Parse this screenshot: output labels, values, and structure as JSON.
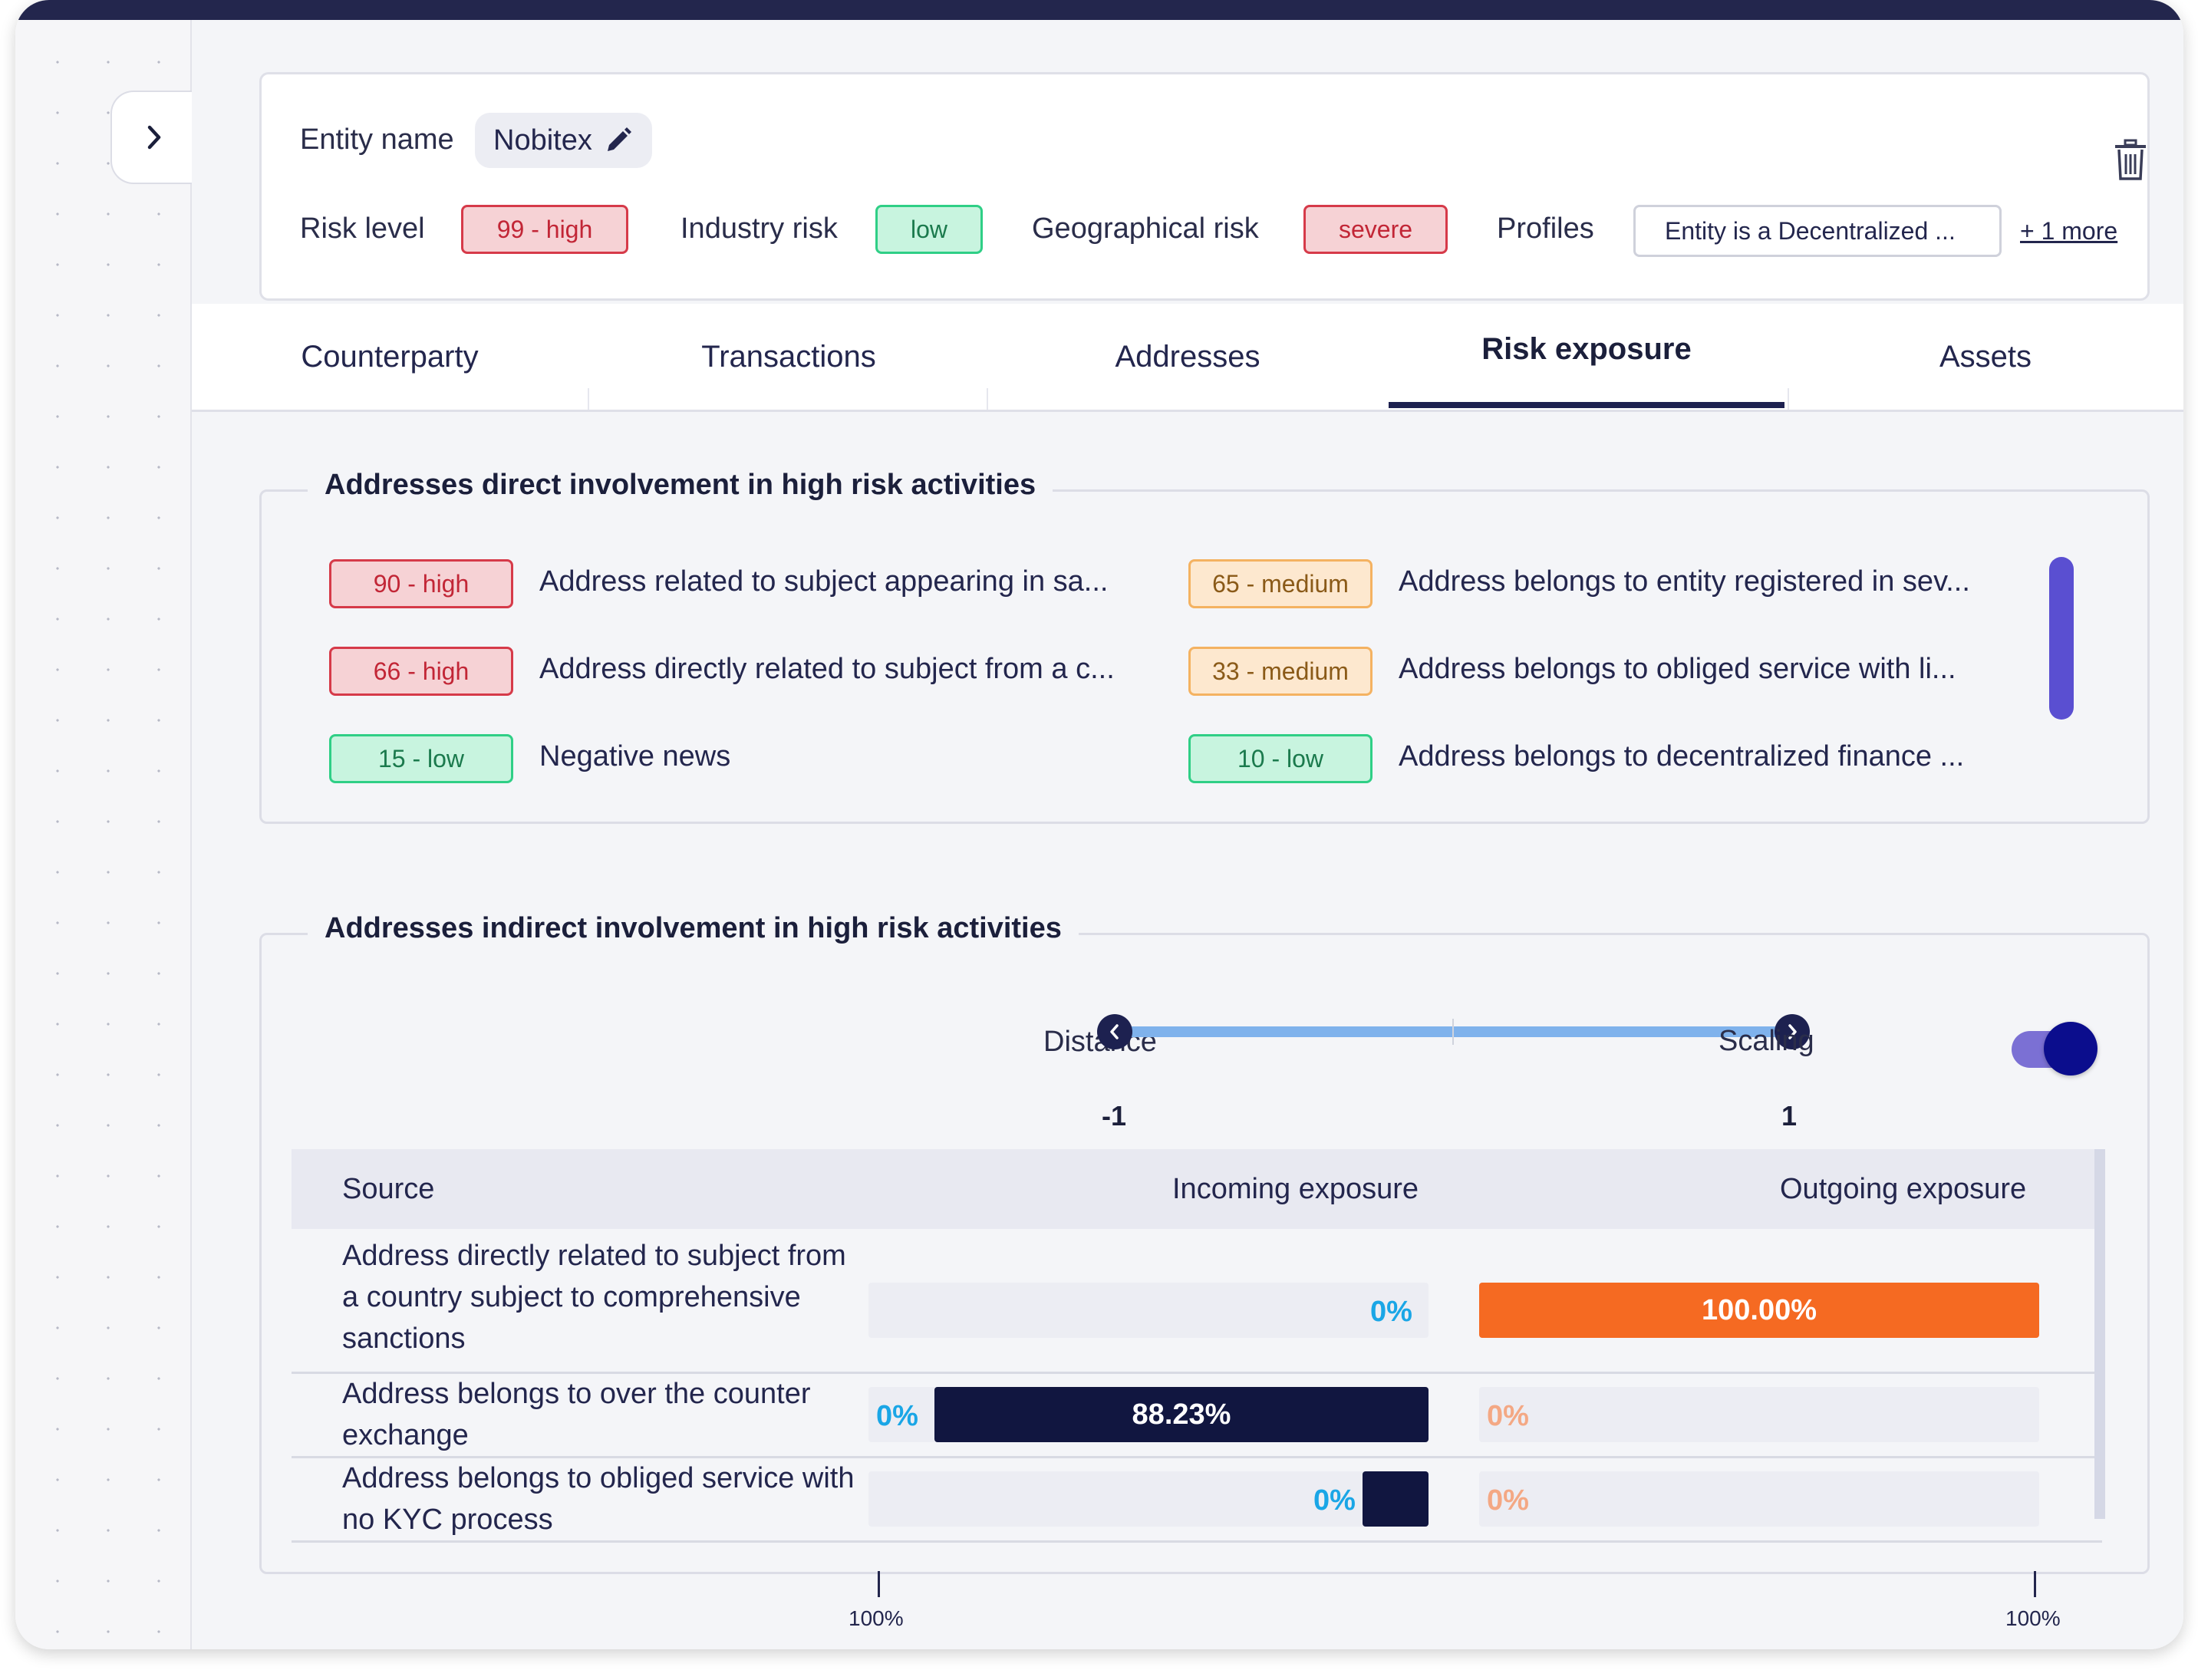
{
  "entity": {
    "name_label": "Entity name",
    "name_value": "Nobitex",
    "risk_level_label": "Risk level",
    "risk_level_value": "99 - high",
    "industry_risk_label": "Industry risk",
    "industry_risk_value": "low",
    "geo_risk_label": "Geographical risk",
    "geo_risk_value": "severe",
    "profiles_label": "Profiles",
    "profiles_value": "Entity is a Decentralized ...",
    "profiles_more": "+ 1 more"
  },
  "tabs": [
    {
      "label": "Counterparty"
    },
    {
      "label": "Transactions"
    },
    {
      "label": "Addresses"
    },
    {
      "label": "Risk exposure"
    },
    {
      "label": "Assets"
    }
  ],
  "active_tab": "Risk exposure",
  "direct": {
    "title": "Addresses direct involvement in high risk activities",
    "items": [
      {
        "score": "90 - high",
        "level": "high",
        "text": "Address related to subject appearing in sa..."
      },
      {
        "score": "65 - medium",
        "level": "medium",
        "text": "Address belongs to entity registered in sev..."
      },
      {
        "score": "66 - high",
        "level": "high",
        "text": "Address directly related to subject from a c..."
      },
      {
        "score": "33 - medium",
        "level": "medium",
        "text": "Address belongs to obliged service with li..."
      },
      {
        "score": "15 - low",
        "level": "low",
        "text": "Negative news"
      },
      {
        "score": "10 - low",
        "level": "low",
        "text": "Address belongs to decentralized finance ..."
      }
    ]
  },
  "indirect": {
    "title": "Addresses indirect involvement in high risk activities",
    "distance_label": "Distance",
    "distance_min": "-1",
    "distance_max": "1",
    "scaling_label": "Scaling",
    "scaling_on": true,
    "columns": {
      "source": "Source",
      "incoming": "Incoming exposure",
      "outgoing": "Outgoing exposure"
    },
    "rows": [
      {
        "source": "Address directly related to subject from a country subject to comprehensive sanctions",
        "incoming_label": "0%",
        "incoming_pct": 0,
        "outgoing_label": "100.00%",
        "outgoing_pct": 100
      },
      {
        "source": "Address belongs to over the counter exchange",
        "incoming_label": "88.23%",
        "incoming_zero_label": "0%",
        "incoming_pct": 88.23,
        "outgoing_label": "0%",
        "outgoing_pct": 0
      },
      {
        "source": "Address belongs to obliged service with no KYC process",
        "incoming_label": "0%",
        "incoming_pct": 11.77,
        "outgoing_label": "0%",
        "outgoing_pct": 0
      }
    ],
    "axis_left": "100%",
    "axis_right": "100%"
  },
  "colors": {
    "navy": "#1d2150",
    "incoming_bar": "#111640",
    "outgoing_bar": "#f56a22",
    "accent_purple": "#5a4fd1"
  },
  "icons": [
    "chevron-right-icon",
    "pencil-icon",
    "trash-icon",
    "chevron-left-icon"
  ]
}
